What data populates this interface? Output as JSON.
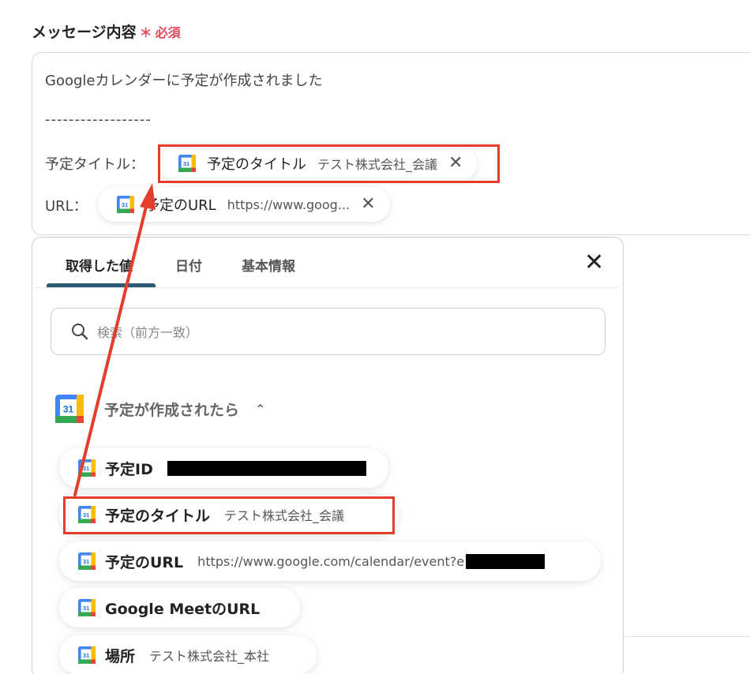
{
  "field": {
    "label": "メッセージ内容",
    "required_mark": "＊",
    "required_text": "必須"
  },
  "message": {
    "line1": "Googleカレンダーに予定が作成されました",
    "line2": "------------------",
    "title_prefix": "予定タイトル：",
    "url_prefix": "URL："
  },
  "inserted_chips": [
    {
      "label": "予定のタイトル",
      "value": "テスト株式会社_会議",
      "remove": "✕"
    },
    {
      "label": "予定のURL",
      "value": "https://www.goog...",
      "remove": "✕"
    }
  ],
  "panel": {
    "tabs": [
      "取得した値",
      "日付",
      "基本情報"
    ],
    "close": "✕",
    "search_placeholder": "検索（前方一致）",
    "group_title": "予定が作成されたら",
    "group_chevron": "⌃",
    "items": [
      {
        "label": "予定ID",
        "value": ""
      },
      {
        "label": "予定のタイトル",
        "value": "テスト株式会社_会議"
      },
      {
        "label": "予定のURL",
        "value": "https://www.google.com/calendar/event?e"
      },
      {
        "label": "Google MeetのURL",
        "value": ""
      },
      {
        "label": "場所",
        "value": "テスト株式会社_本社"
      }
    ]
  },
  "icons": {
    "calendar": "google-calendar-icon",
    "calendar_day": "31",
    "search": "search-icon"
  },
  "colors": {
    "highlight": "#e43d2b",
    "required": "#e2485b",
    "tab_active": "#2b5a73",
    "gcal_blue": "#4285f4",
    "gcal_green": "#34a853",
    "gcal_yellow": "#fbbc04",
    "gcal_red": "#ea4335"
  }
}
